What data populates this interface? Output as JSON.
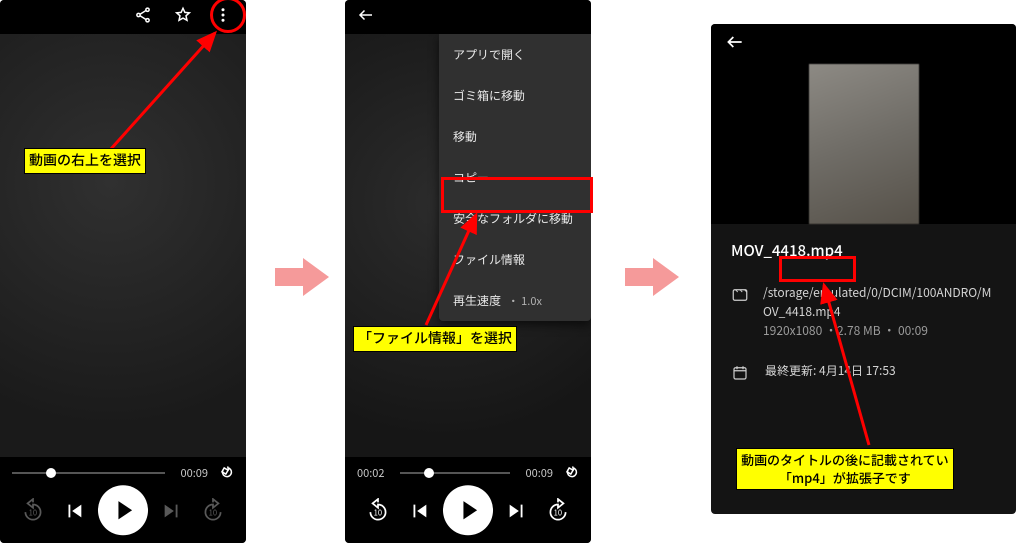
{
  "annotations": {
    "step1": "動画の右上を選択",
    "step2": "「ファイル情報」を選択",
    "step3": "動画のタイトルの後に記載されてい\n「mp4」が拡張子です"
  },
  "panel1": {
    "time": "00:09"
  },
  "panel2": {
    "menu": {
      "open_with": "アプリで開く",
      "move_trash": "ゴミ箱に移動",
      "move": "移動",
      "copy": "コピー",
      "move_safe": "安全なフォルダに移動",
      "file_info": "ファイル情報",
      "playback_speed": "再生速度",
      "speed_value": "・ 1.0x"
    },
    "time_l": "00:02",
    "time_r": "00:09"
  },
  "panel3": {
    "filename": "MOV_4418.mp4",
    "path": "/storage/emulated/0/DCIM/100ANDRO/MOV_4418.mp4",
    "meta_line": "1920x1080  ・2.78 MB  ・ 00:09",
    "updated_label": "最終更新:",
    "updated_value": "4月14日 17:53"
  }
}
